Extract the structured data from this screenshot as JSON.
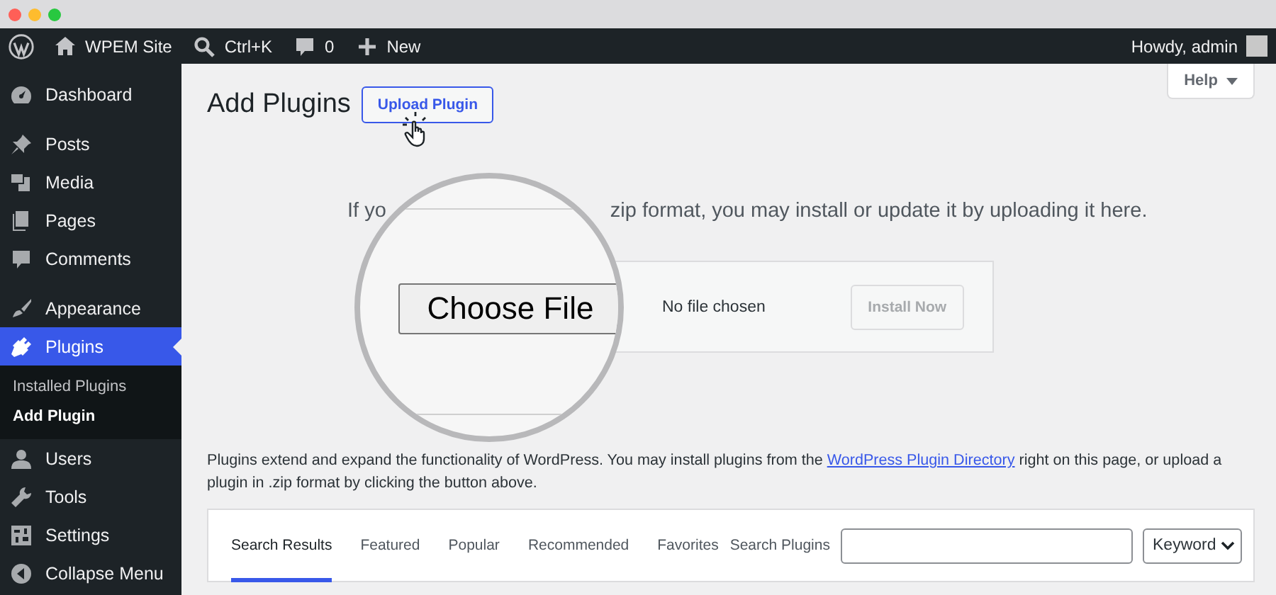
{
  "admin_bar": {
    "items": [
      {
        "kind": "home",
        "label": "WPEM Site"
      },
      {
        "kind": "search",
        "label": "Ctrl+K"
      },
      {
        "kind": "comment",
        "label": "0"
      },
      {
        "kind": "plus",
        "label": "New"
      }
    ],
    "account": "Howdy, admin"
  },
  "sidebar": {
    "groups": [
      {
        "items": [
          {
            "kind": "dashboard",
            "label": "Dashboard",
            "selected": false
          }
        ]
      },
      {
        "items": [
          {
            "kind": "pin",
            "label": "Posts",
            "selected": false
          },
          {
            "kind": "media",
            "label": "Media",
            "selected": false
          },
          {
            "kind": "pages",
            "label": "Pages",
            "selected": false
          },
          {
            "kind": "comment",
            "label": "Comments",
            "selected": false
          }
        ]
      },
      {
        "items": [
          {
            "kind": "brush",
            "label": "Appearance",
            "selected": false
          },
          {
            "kind": "plug",
            "label": "Plugins",
            "selected": true,
            "children": [
              {
                "label": "Installed Plugins",
                "selected": false
              },
              {
                "label": "Add Plugin",
                "selected": true
              }
            ]
          },
          {
            "kind": "user",
            "label": "Users",
            "selected": false
          },
          {
            "kind": "wrench",
            "label": "Tools",
            "selected": false
          },
          {
            "kind": "settings",
            "label": "Settings",
            "selected": false
          },
          {
            "kind": "collapse",
            "label": "Collapse Menu",
            "selected": false
          }
        ]
      }
    ]
  },
  "help_button": "Help",
  "page": {
    "title": "Add Plugins",
    "upload_button": "Upload Plugin"
  },
  "upload": {
    "intro_start": "If yo",
    "intro_end": "zip format, you may install or update it by uploading it here.",
    "choose_file_button": "Choose File",
    "file_status": "No file chosen",
    "install_button": {
      "label": "Install Now",
      "disabled": true
    }
  },
  "description": {
    "before": "Plugins extend and expand the functionality of WordPress. You may install plugins from the",
    "link": "WordPress Plugin Directory",
    "after": "right on this page, or upload a plugin in .zip format by clicking the button above."
  },
  "filter": {
    "tabs": [
      {
        "label": "Search Results",
        "selected": true
      },
      {
        "label": "Featured",
        "selected": false
      },
      {
        "label": "Popular",
        "selected": false
      },
      {
        "label": "Recommended",
        "selected": false
      },
      {
        "label": "Favorites",
        "selected": false
      }
    ],
    "search_label": "Search Plugins",
    "search_type": "Keyword"
  }
}
